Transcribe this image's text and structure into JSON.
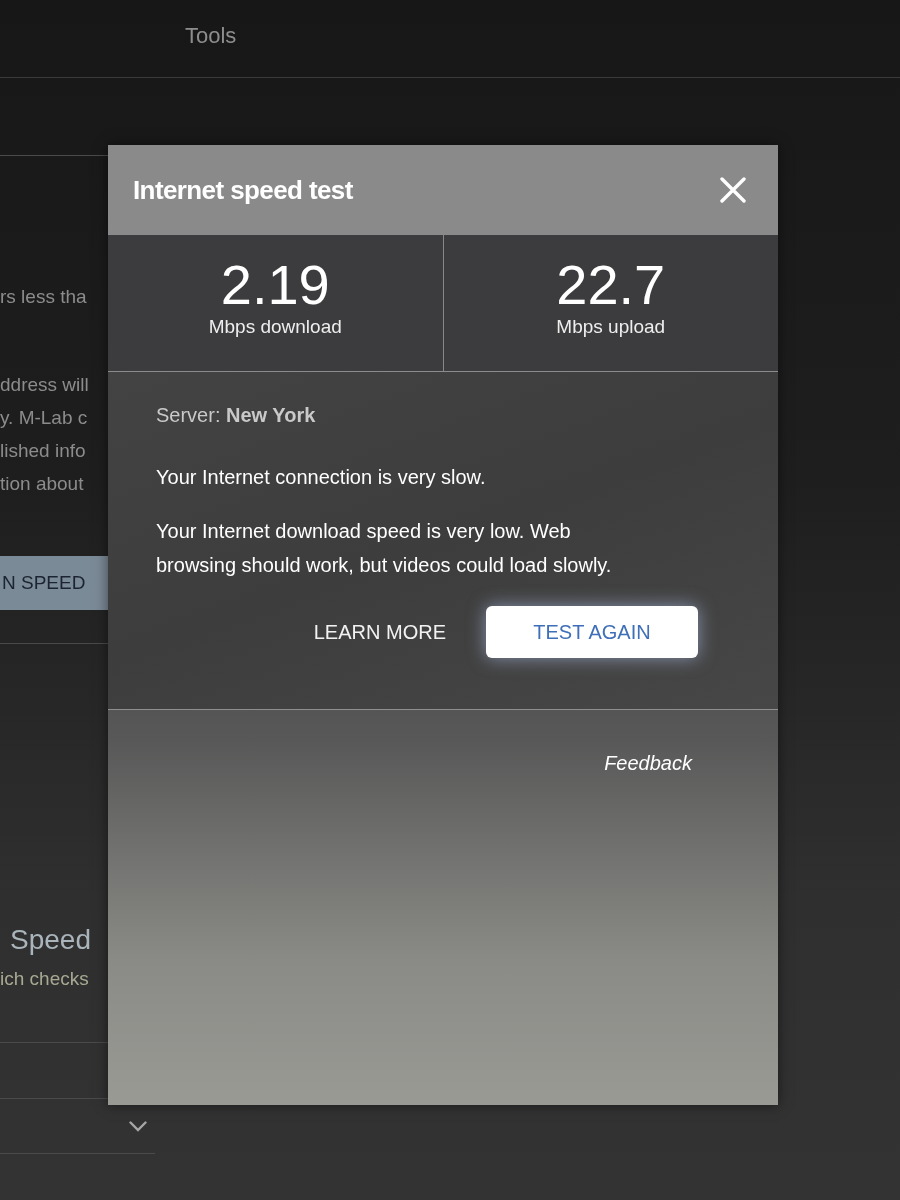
{
  "background_page": {
    "header": {
      "title": "Tools"
    },
    "text_lines": [
      "rs less tha",
      "ddress will",
      "y. M-Lab c",
      "lished info",
      "tion about"
    ],
    "button": {
      "label": "N SPEED"
    },
    "section": {
      "heading": "Speed",
      "text": "ich checks"
    }
  },
  "dialog": {
    "title": "Internet speed test",
    "results": [
      {
        "value": "2.19",
        "unit": "Mbps download"
      },
      {
        "value": "22.7",
        "unit": "Mbps upload"
      }
    ],
    "server": "Server: **New York**",
    "messages": [
      "Your Internet connection is very slow.",
      "Your Internet download speed is very low. Web browsing should work, but videos could load slowly."
    ],
    "actions": [
      {
        "label": "LEARN MORE",
        "kind": "text"
      },
      {
        "label": "TEST AGAIN",
        "kind": "primary"
      }
    ],
    "feedback": "Feedback"
  }
}
